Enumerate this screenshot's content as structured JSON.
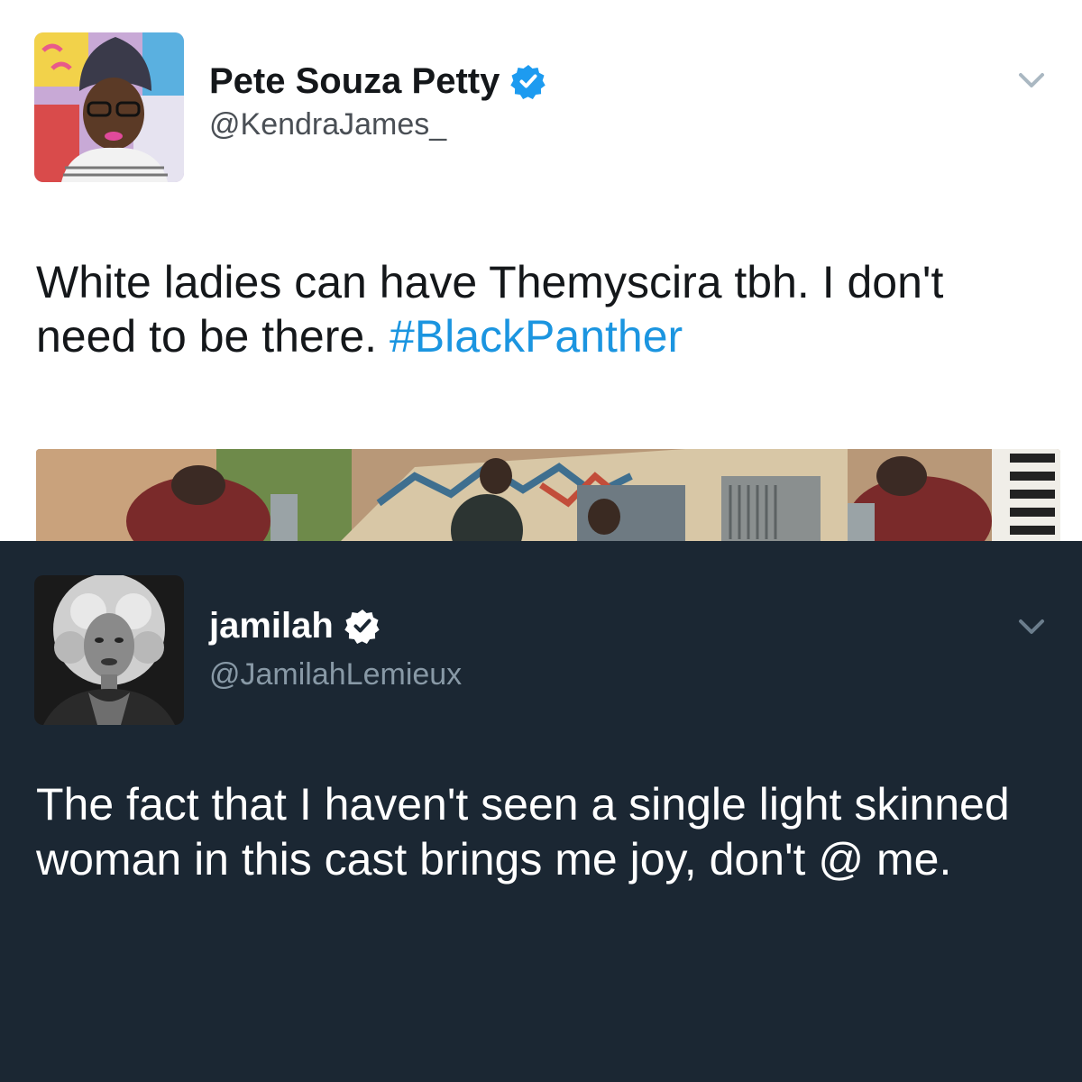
{
  "tweets": [
    {
      "display_name": "Pete Souza Petty",
      "handle": "@KendraJames_",
      "text_before_hashtag": "White ladies can have Themyscira tbh. I don't need to be there. ",
      "hashtag": "#BlackPanther",
      "verified": true,
      "theme": "light",
      "icons": {
        "verified": "verified-badge-icon",
        "menu": "chevron-down-icon"
      }
    },
    {
      "display_name": "jamilah",
      "handle": "@JamilahLemieux",
      "text": "The fact that I haven't seen a single light skinned woman in this cast brings me joy, don't @ me.",
      "verified": true,
      "theme": "dark",
      "icons": {
        "verified": "verified-badge-icon",
        "menu": "chevron-down-icon"
      }
    }
  ],
  "colors": {
    "light_bg": "#ffffff",
    "dark_bg": "#1b2733",
    "hashtag": "#1b95e0",
    "verified_blue": "#1d9bf0"
  }
}
